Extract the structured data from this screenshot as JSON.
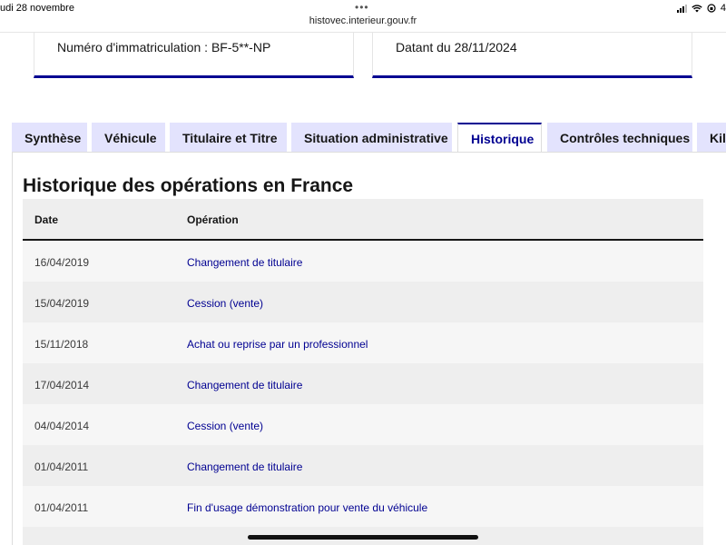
{
  "status_bar": {
    "date": "udi 28 novembre",
    "url": "histovec.interieur.gouv.fr",
    "dots": "•••",
    "battery": "4"
  },
  "cards": [
    {
      "text": "Numéro d'immatriculation : BF-5**-NP"
    },
    {
      "text": "Datant du 28/11/2024"
    }
  ],
  "tabs": [
    {
      "label": "Synthèse",
      "active": false
    },
    {
      "label": "Véhicule",
      "active": false
    },
    {
      "label": "Titulaire et Titre",
      "active": false
    },
    {
      "label": "Situation administrative",
      "active": false
    },
    {
      "label": "Historique",
      "active": true
    },
    {
      "label": "Contrôles techniques",
      "active": false
    },
    {
      "label": "Kilo",
      "active": false
    }
  ],
  "section": {
    "title": "Historique des opérations en France"
  },
  "table": {
    "headers": {
      "date": "Date",
      "operation": "Opération"
    },
    "rows": [
      {
        "date": "16/04/2019",
        "operation": "Changement de titulaire"
      },
      {
        "date": "15/04/2019",
        "operation": "Cession (vente)"
      },
      {
        "date": "15/11/2018",
        "operation": "Achat ou reprise par un professionnel"
      },
      {
        "date": "17/04/2014",
        "operation": "Changement de titulaire"
      },
      {
        "date": "04/04/2014",
        "operation": "Cession (vente)"
      },
      {
        "date": "01/04/2011",
        "operation": "Changement de titulaire"
      },
      {
        "date": "01/04/2011",
        "operation": "Fin d'usage démonstration pour vente du véhicule"
      },
      {
        "date": "",
        "operation": ""
      }
    ]
  },
  "colors": {
    "accent": "#000091",
    "tab_bg": "#e3e3fd"
  }
}
